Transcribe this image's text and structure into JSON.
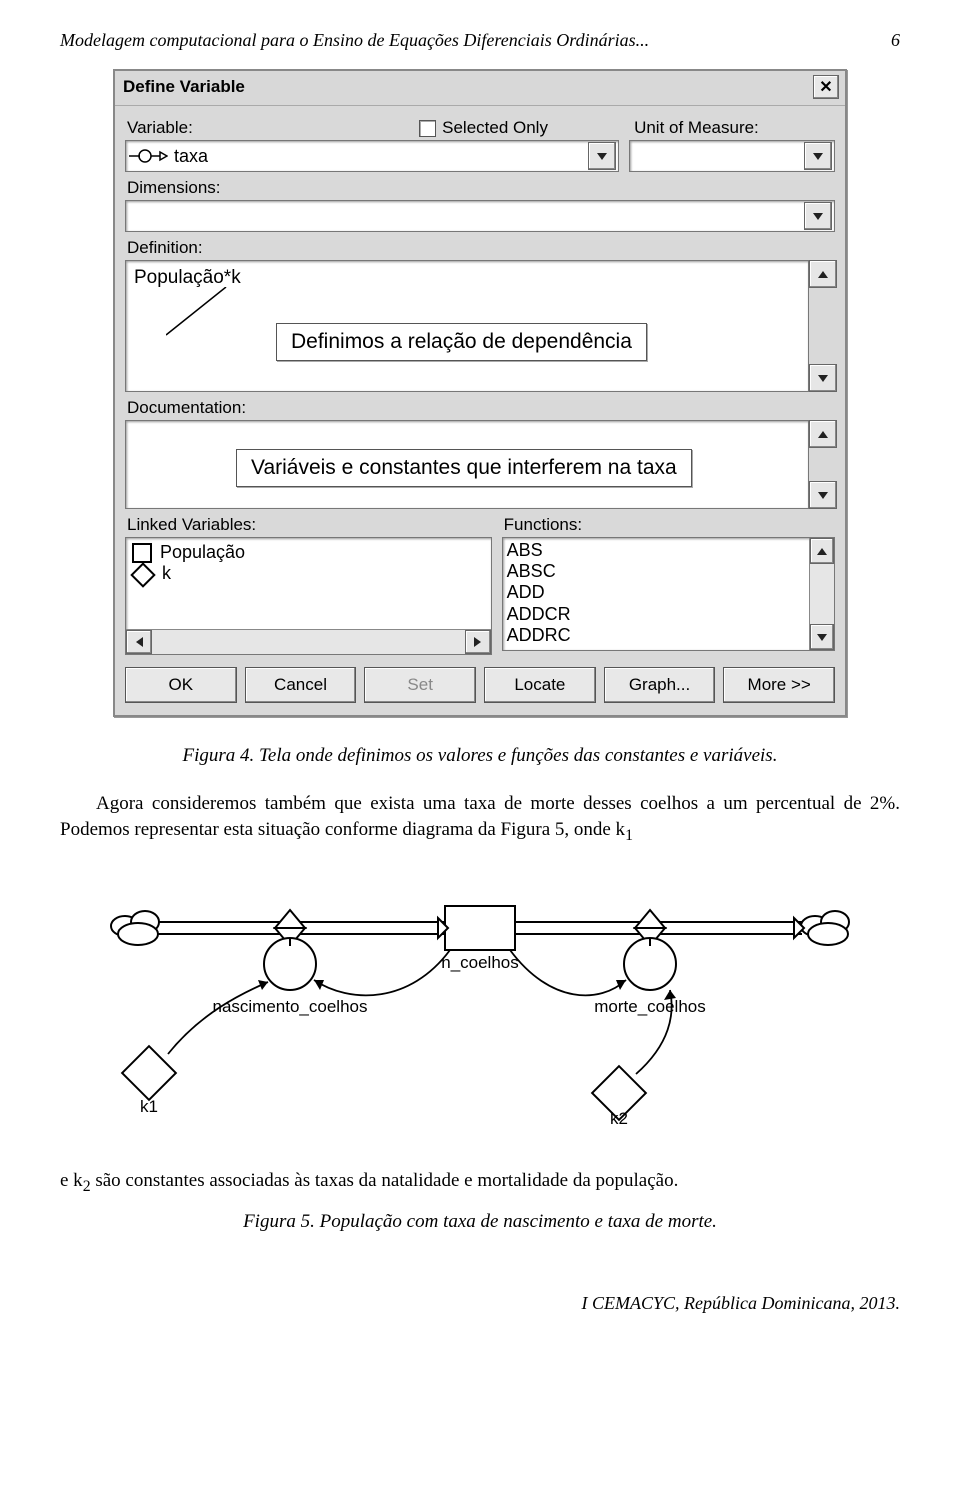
{
  "header": {
    "running_title": "Modelagem computacional para o Ensino de Equações Diferenciais Ordinárias...",
    "page_number": "6"
  },
  "dialog": {
    "title": "Define Variable",
    "close_glyph": "✕",
    "labels": {
      "variable": "Variable:",
      "selected_only": "Selected Only",
      "unit_of_measure": "Unit of Measure:",
      "dimensions": "Dimensions:",
      "definition": "Definition:",
      "documentation": "Documentation:",
      "linked_variables": "Linked Variables:",
      "functions": "Functions:"
    },
    "variable_value": "taxa",
    "unit_value": "",
    "dimensions_value": "",
    "definition_value": "População*k",
    "definition_tooltip": "Definimos a relação de dependência",
    "documentation_tooltip": "Variáveis e constantes que interferem na taxa",
    "linked_variables": [
      "População",
      "k"
    ],
    "functions": [
      "ABS",
      "ABSC",
      "ADD",
      "ADDCR",
      "ADDRC"
    ],
    "buttons": {
      "ok": "OK",
      "cancel": "Cancel",
      "set": "Set",
      "locate": "Locate",
      "graph": "Graph...",
      "more": "More >>"
    }
  },
  "caption4": "Figura 4. Tela onde definimos os valores e funções das constantes e variáveis.",
  "para1_a": "Agora consideremos também que exista uma taxa de morte desses coelhos a um percentual de 2%. Podemos representar esta situação conforme diagrama da Figura 5, onde k",
  "para1_sub": "1",
  "diagram": {
    "nascimento_label": "nascimento_coelhos",
    "n_label": "n_coelhos",
    "morte_label": "morte_coelhos",
    "k1": "k1",
    "k2": "k2"
  },
  "para2_a": "e k",
  "para2_sub": "2",
  "para2_b": " são constantes associadas às taxas da natalidade e mortalidade da população.",
  "caption5": "Figura 5. População com taxa de nascimento e taxa de morte.",
  "footer": "I CEMACYC, República Dominicana, 2013."
}
